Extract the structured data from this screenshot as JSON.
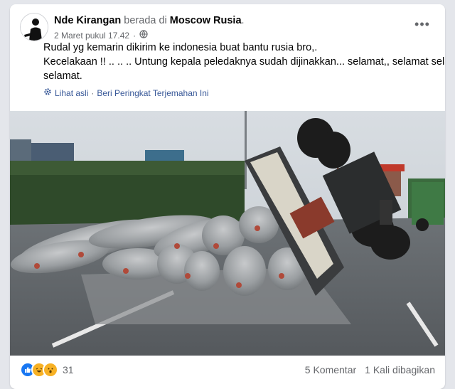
{
  "post": {
    "author": "Nde Kirangan",
    "location_prefix": "berada di",
    "location": "Moscow Rusia",
    "location_suffix": ".",
    "date": "2 Maret pukul 17.42",
    "separator": "·",
    "privacy_icon": "globe-icon",
    "text_lines": [
      "Rudal yg kemarin dikirim ke indonesia buat bantu rusia bro,.",
      "Kecelakaan !! .. .. .. Untung kepala peledaknya sudah dijinakkan... selamat,, selamat selamat",
      "selamat."
    ],
    "see_original": "Lihat asli",
    "rate_translation": "Beri Peringkat Terjemahan Ini",
    "more_icon": "more-options-icon"
  },
  "photo": {
    "icon": "photo-image"
  },
  "footer": {
    "reaction_icons": [
      "like-icon",
      "haha-icon",
      "wow-icon"
    ],
    "reaction_count": "31",
    "comments": "5 Komentar",
    "shares": "1 Kali dibagikan"
  },
  "colors": {
    "link": "#385898",
    "muted": "#65676b",
    "like": "#1877f2"
  }
}
